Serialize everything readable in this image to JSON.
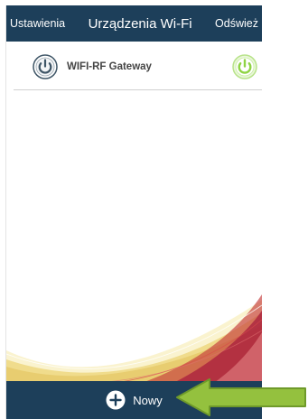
{
  "colors": {
    "bar": "#1d3f5a",
    "device_icon": "#3e5566",
    "state_on": "#8fd444",
    "arrow_fill": "#94c13e",
    "arrow_stroke": "#6f9a2a"
  },
  "header": {
    "settings_label": "Ustawienia",
    "title": "Urządzenia Wi-Fi",
    "refresh_label": "Odśwież"
  },
  "devices": [
    {
      "name": "WIFI-RF Gateway",
      "icon": "power-icon",
      "state": "on",
      "state_icon": "power-on-icon"
    }
  ],
  "footer": {
    "new_label": "Nowy",
    "new_icon": "plus-circle-icon"
  },
  "annotation": {
    "icon": "arrow-left-icon"
  }
}
